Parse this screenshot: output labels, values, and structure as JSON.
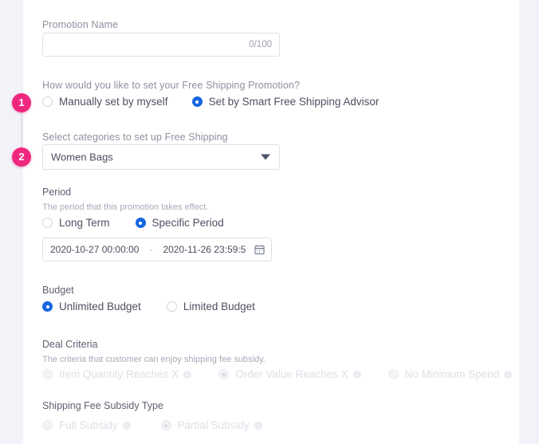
{
  "theme": {
    "page_background": "#f2f3f9",
    "card_background": "#ffffff",
    "accent_blue": "#1566e0",
    "badge_pink": "#f0277f",
    "label_gray": "#8f90a0",
    "disabled_gray": "#dedfe7"
  },
  "steps": [
    {
      "number": "1",
      "name": "promotion-method-step"
    },
    {
      "number": "2",
      "name": "category-select-step"
    }
  ],
  "form": {
    "promotion_name": {
      "label": "Promotion Name",
      "value": "",
      "placeholder": "",
      "counter": "0/100"
    },
    "setup_method": {
      "label": "How would you like to set your Free Shipping Promotion?",
      "options": [
        {
          "label": "Manually set by myself",
          "checked": false
        },
        {
          "label": "Set by Smart Free Shipping Advisor",
          "checked": true
        }
      ]
    },
    "categories": {
      "label": "Select categories to set up Free Shipping",
      "selected": "Women Bags",
      "caret_icon": "chevron-down-icon"
    },
    "period": {
      "title": "Period",
      "subtitle": "The period that this promotion takes effect.",
      "options": [
        {
          "label": "Long Term",
          "checked": false
        },
        {
          "label": "Specific Period",
          "checked": true
        }
      ],
      "range": {
        "start": "2020-10-27 00:00:00",
        "separator": "-",
        "end": "2020-11-26 23:59:5",
        "icon": "calendar-icon"
      }
    },
    "budget": {
      "title": "Budget",
      "options": [
        {
          "label": "Unlimited Budget",
          "checked": true
        },
        {
          "label": "Limited Budget",
          "checked": false
        }
      ]
    },
    "deal_criteria": {
      "title": "Deal Criteria",
      "subtitle": "The criteria that customer can enjoy shipping fee subsidy.",
      "disabled": true,
      "options": [
        {
          "label": "Item Quantity Reaches X",
          "checked": false,
          "info": "i"
        },
        {
          "label": "Order Value Reaches X",
          "checked": true,
          "info": "i"
        },
        {
          "label": "No Minimum Spend",
          "checked": false,
          "info": "i"
        }
      ]
    },
    "subsidy_type": {
      "title": "Shipping Fee Subsidy Type",
      "disabled": true,
      "options": [
        {
          "label": "Full Subsidy",
          "checked": false,
          "info": "i"
        },
        {
          "label": "Partial Subsidy",
          "checked": true,
          "info": "i"
        }
      ]
    }
  }
}
